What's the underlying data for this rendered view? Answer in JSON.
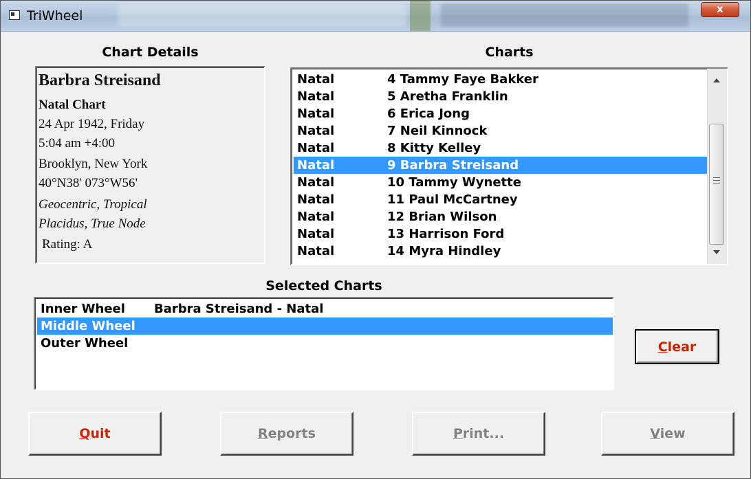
{
  "window": {
    "title": "TriWheel",
    "close_glyph": "x"
  },
  "chart_details": {
    "heading": "Chart Details",
    "name": "Barbra Streisand",
    "chart_type": "Natal Chart",
    "date": "24 Apr 1942, Friday",
    "time": "5:04 am  +4:00",
    "place": "Brooklyn, New York",
    "coordinates": "40°N38' 073°W56'",
    "system": "Geocentric, Tropical",
    "houses": "Placidus, True Node",
    "rating": "Rating: A"
  },
  "charts": {
    "heading": "Charts",
    "items": [
      {
        "type": "Natal",
        "name": "4 Tammy Faye Bakker"
      },
      {
        "type": "Natal",
        "name": "5 Aretha Franklin"
      },
      {
        "type": "Natal",
        "name": "6 Erica Jong"
      },
      {
        "type": "Natal",
        "name": "7 Neil Kinnock"
      },
      {
        "type": "Natal",
        "name": "8 Kitty Kelley"
      },
      {
        "type": "Natal",
        "name": "9 Barbra Streisand"
      },
      {
        "type": "Natal",
        "name": "10 Tammy Wynette"
      },
      {
        "type": "Natal",
        "name": "11 Paul McCartney"
      },
      {
        "type": "Natal",
        "name": "12 Brian Wilson"
      },
      {
        "type": "Natal",
        "name": "13 Harrison Ford"
      },
      {
        "type": "Natal",
        "name": "14 Myra Hindley"
      }
    ],
    "selected_index": 5
  },
  "selected_charts": {
    "heading": "Selected Charts",
    "rows": [
      {
        "wheel": "Inner Wheel",
        "chart": "Barbra Streisand - Natal"
      },
      {
        "wheel": "Middle Wheel",
        "chart": ""
      },
      {
        "wheel": "Outer Wheel",
        "chart": ""
      }
    ],
    "selected_index": 1
  },
  "buttons": {
    "clear": {
      "mnemonic": "C",
      "rest": "lear"
    },
    "quit": {
      "mnemonic": "Q",
      "rest": "uit"
    },
    "reports": {
      "mnemonic": "R",
      "rest": "eports"
    },
    "print": {
      "mnemonic": "P",
      "rest": "rint..."
    },
    "view": {
      "mnemonic": "V",
      "rest": "iew"
    }
  },
  "colors": {
    "selection": "#3399ff",
    "accent_button_text": "#cc2200",
    "disabled_text": "#808080"
  }
}
